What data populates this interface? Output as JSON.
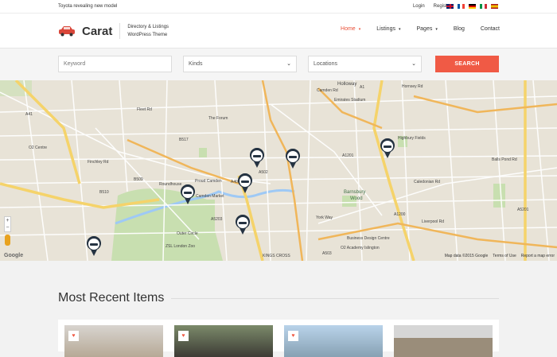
{
  "topbar": {
    "news": "Toyota revealing new model",
    "login": "Login",
    "register": "Register",
    "flags": [
      "uk-flag",
      "fr-flag",
      "de-flag",
      "it-flag",
      "es-flag"
    ]
  },
  "header": {
    "brand": "Carat",
    "tagline_1": "Directory & Listings",
    "tagline_2": "WordPress Theme",
    "nav": [
      {
        "label": "Home",
        "caret": "▾"
      },
      {
        "label": "Listings",
        "caret": "▾"
      },
      {
        "label": "Pages",
        "caret": "▾"
      },
      {
        "label": "Blog"
      },
      {
        "label": "Contact"
      }
    ],
    "accent": "#e94f37"
  },
  "search": {
    "keyword_placeholder": "Keyword",
    "kinds_value": "Kinds",
    "locations_value": "Locations",
    "button_label": "SEARCH",
    "button_color": "#f05a45"
  },
  "map": {
    "labels": {
      "holloway": "Holloway",
      "emirates": "Emirates Stadium",
      "highbury": "Highbury Fields",
      "barnsbury": "Barnsbury",
      "wood": "Wood",
      "camden": "Proud Camden",
      "market": "Camden Market",
      "roundhouse": "Roundhouse",
      "forum": "The Forum",
      "kings": "KINGS CROSS",
      "zsl": "ZSL London Zoo",
      "business": "Business Design Centre",
      "islington": "O2 Academy Islington",
      "o2": "O2 Centre",
      "a1": "A1",
      "a503": "A503",
      "a400": "A400",
      "a5201": "A5201",
      "a41": "A41",
      "a502": "A502",
      "a5203": "A5203",
      "a1200": "A1200",
      "a1201": "A1201",
      "b510": "B510",
      "b509": "B509",
      "b517": "B517",
      "camden_rd": "Camden Rd",
      "caledonian": "Caledonian Rd",
      "fleet": "Fleet Rd",
      "finchley": "Finchley Rd",
      "york_way": "York Way",
      "balls_pond": "Balls Pond Rd",
      "outer_circle": "Outer Circle",
      "hornsey": "Hornsey Rd",
      "liverpool": "Liverpool Rd"
    },
    "zoom_in": "+",
    "zoom_out": "−",
    "google": "Google",
    "attrib_data": "Map data ©2015 Google",
    "attrib_terms": "Terms of Use",
    "attrib_report": "Report a map error"
  },
  "recent": {
    "title": "Most Recent Items",
    "heart_icon": "♥"
  }
}
